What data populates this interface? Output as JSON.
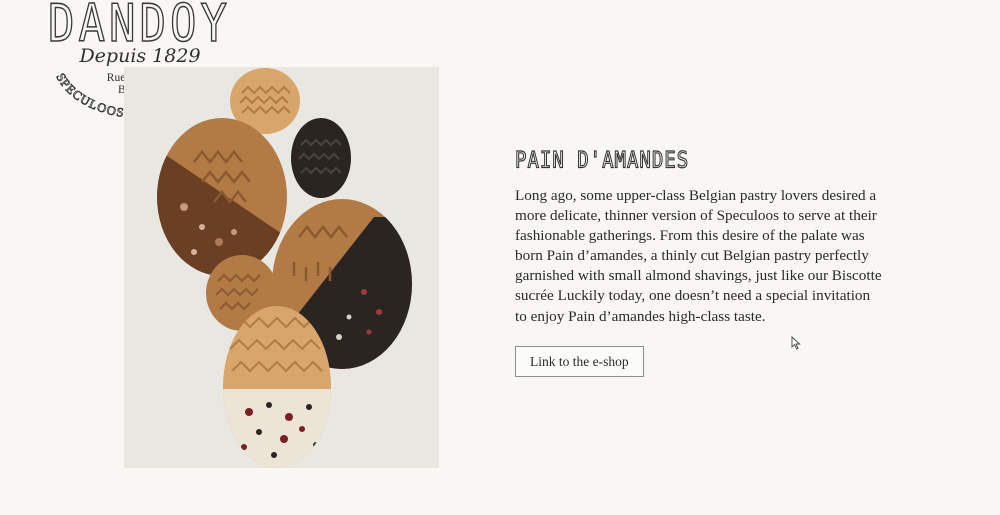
{
  "logo": {
    "brand": "DANDOY",
    "since": "Depuis 1829",
    "address_line1": "Rue au Beurre",
    "address_line2": "Bruxelles",
    "arc_text": "SPECULOOS SPECTACULOOS"
  },
  "product": {
    "title": "PAIN D'AMANDES",
    "description": "Long ago, some upper-class Belgian pastry lovers desired a more delicate, thinner version of Speculoos to serve at their fashionable gatherings. From this desire of the palate was born Pain d’amandes, a thinly cut Belgian pastry perfectly garnished with small almond shavings, just like our Biscotte sucrée Luckily today, one doesn’t need a special invitation to enjoy Pain d’amandes high-class taste.",
    "button_label": "Link to the e-shop",
    "image_alt": "Egg-shaped speculoos biscuits with chocolate coating"
  },
  "colors": {
    "background": "#f8f7f3",
    "panel": "#e9e7e2",
    "biscuit": "#d8a56a",
    "biscuit_dark": "#b27a45",
    "chocolate_milk": "#6b3f24",
    "chocolate_dark": "#2b2522",
    "white_chocolate": "#ece4d4"
  }
}
